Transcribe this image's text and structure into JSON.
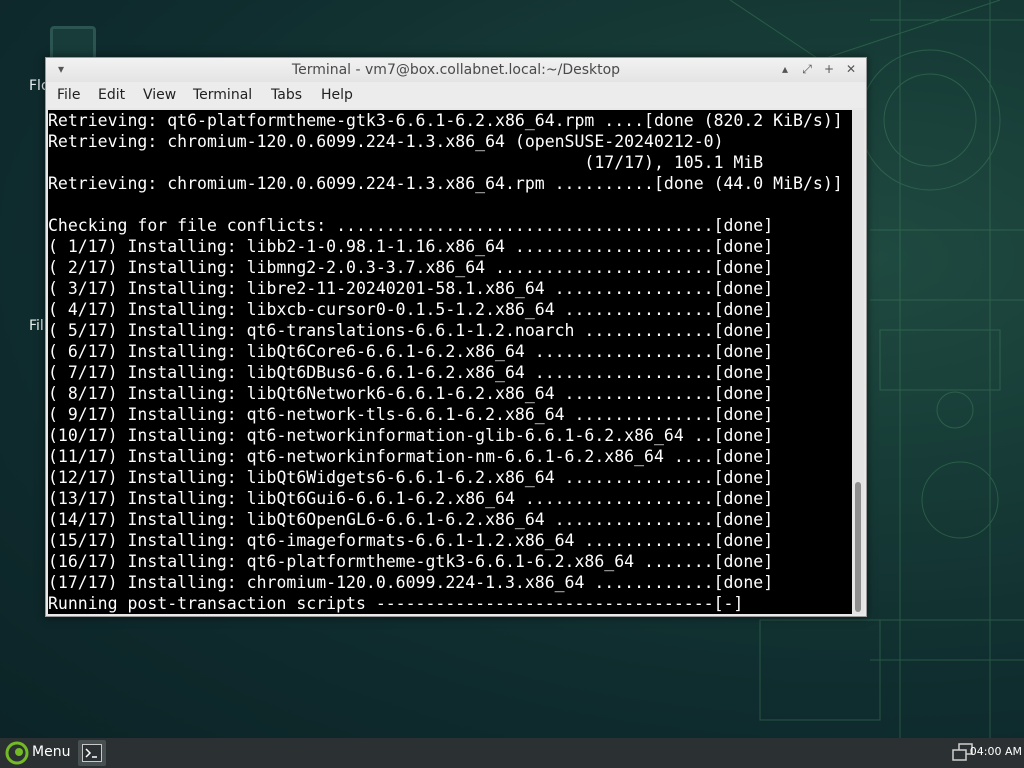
{
  "desktop": {
    "icons": [
      {
        "label": "Flo"
      },
      {
        "label": "Fil"
      }
    ]
  },
  "window": {
    "title": "Terminal - vm7@box.collabnet.local:~/Desktop",
    "menu": [
      "File",
      "Edit",
      "View",
      "Terminal",
      "Tabs",
      "Help"
    ],
    "buttons": {
      "menu": "▾",
      "up": "▴",
      "restore": "⤢",
      "close": "✕"
    }
  },
  "terminal": {
    "lines": [
      "Retrieving: qt6-platformtheme-gtk3-6.6.1-6.2.x86_64.rpm ....[done (820.2 KiB/s)]",
      "Retrieving: chromium-120.0.6099.224-1.3.x86_64 (openSUSE-20240212-0)",
      "                                                      (17/17), 105.1 MiB",
      "Retrieving: chromium-120.0.6099.224-1.3.x86_64.rpm ..........[done (44.0 MiB/s)]",
      "",
      "Checking for file conflicts: ......................................[done]",
      "( 1/17) Installing: libb2-1-0.98.1-1.16.x86_64 ....................[done]",
      "( 2/17) Installing: libmng2-2.0.3-3.7.x86_64 ......................[done]",
      "( 3/17) Installing: libre2-11-20240201-58.1.x86_64 ................[done]",
      "( 4/17) Installing: libxcb-cursor0-0.1.5-1.2.x86_64 ...............[done]",
      "( 5/17) Installing: qt6-translations-6.6.1-1.2.noarch .............[done]",
      "( 6/17) Installing: libQt6Core6-6.6.1-6.2.x86_64 ..................[done]",
      "( 7/17) Installing: libQt6DBus6-6.6.1-6.2.x86_64 ..................[done]",
      "( 8/17) Installing: libQt6Network6-6.6.1-6.2.x86_64 ...............[done]",
      "( 9/17) Installing: qt6-network-tls-6.6.1-6.2.x86_64 ..............[done]",
      "(10/17) Installing: qt6-networkinformation-glib-6.6.1-6.2.x86_64 ..[done]",
      "(11/17) Installing: qt6-networkinformation-nm-6.6.1-6.2.x86_64 ....[done]",
      "(12/17) Installing: libQt6Widgets6-6.6.1-6.2.x86_64 ...............[done]",
      "(13/17) Installing: libQt6Gui6-6.6.1-6.2.x86_64 ...................[done]",
      "(14/17) Installing: libQt6OpenGL6-6.6.1-6.2.x86_64 ................[done]",
      "(15/17) Installing: qt6-imageformats-6.6.1-1.2.x86_64 .............[done]",
      "(16/17) Installing: qt6-platformtheme-gtk3-6.6.1-6.2.x86_64 .......[done]",
      "(17/17) Installing: chromium-120.0.6099.224-1.3.x86_64 ............[done]",
      "Running post-transaction scripts ----------------------------------[-]"
    ]
  },
  "taskbar": {
    "menu_label": "Menu",
    "clock": "04:00 AM"
  },
  "colors": {
    "terminal_bg": "#000000",
    "terminal_fg": "#ffffff",
    "taskbar_bg": "#2b3132",
    "opensuse_green": "#73ba25"
  }
}
